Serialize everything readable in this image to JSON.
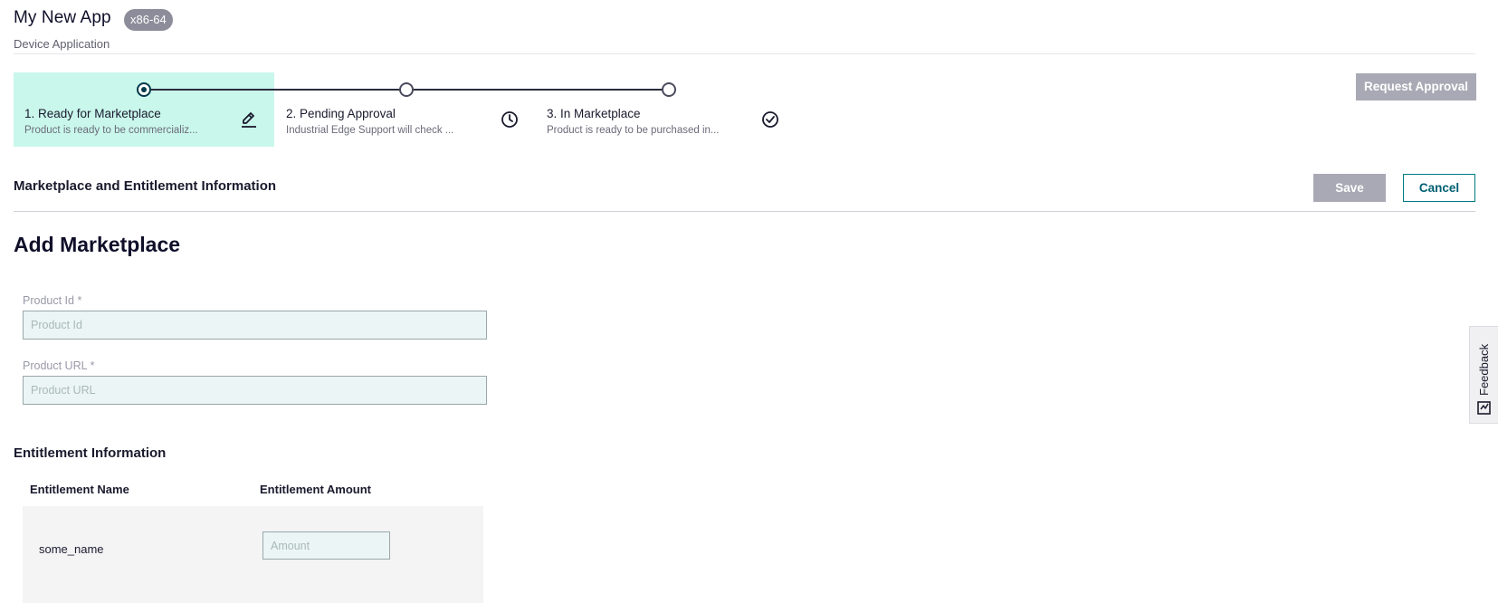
{
  "header": {
    "app_title": "My New App",
    "arch_badge": "x86-64",
    "subtitle": "Device Application"
  },
  "stepper": {
    "steps": [
      {
        "title": "1. Ready for Marketplace",
        "description": "Product is ready to be commercializ...",
        "icon": "pencil-icon",
        "state": "current"
      },
      {
        "title": "2. Pending Approval",
        "description": "Industrial Edge Support will check ...",
        "icon": "clock-icon",
        "state": "upcoming"
      },
      {
        "title": "3. In Marketplace",
        "description": "Product is ready to be purchased in...",
        "icon": "check-circle-icon",
        "state": "upcoming"
      }
    ],
    "request_approval_label": "Request Approval"
  },
  "section": {
    "title": "Marketplace and Entitlement Information",
    "save_label": "Save",
    "cancel_label": "Cancel"
  },
  "form": {
    "heading": "Add Marketplace",
    "product_id": {
      "label": "Product Id *",
      "placeholder": "Product Id",
      "value": ""
    },
    "product_url": {
      "label": "Product URL *",
      "placeholder": "Product URL",
      "value": ""
    }
  },
  "entitlement": {
    "heading": "Entitlement Information",
    "columns": [
      "Entitlement Name",
      "Entitlement Amount"
    ],
    "rows": [
      {
        "name": "some_name",
        "amount_placeholder": "Amount",
        "amount_value": ""
      }
    ]
  },
  "feedback": {
    "label": "Feedback"
  },
  "colors": {
    "active_step_bg": "#c9f7eb",
    "primary_dark": "#00394a",
    "disabled_button": "#a9a9b5",
    "cancel_border": "#007b83",
    "field_bg": "#ebf5f5"
  }
}
